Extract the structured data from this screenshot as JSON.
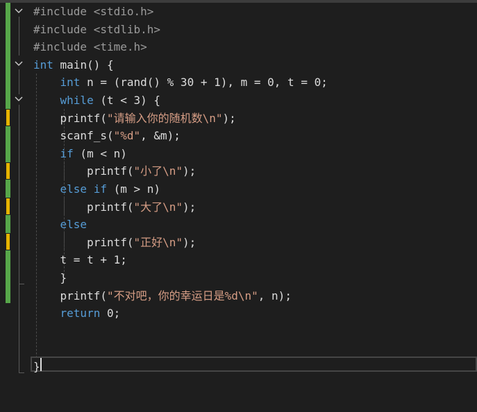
{
  "editor": {
    "language": "C",
    "lines": [
      {
        "tokens": [
          {
            "t": "#include ",
            "c": "pp"
          },
          {
            "t": "<stdio.h>",
            "c": "pp"
          }
        ]
      },
      {
        "tokens": [
          {
            "t": "#include ",
            "c": "pp"
          },
          {
            "t": "<stdlib.h>",
            "c": "pp"
          }
        ]
      },
      {
        "tokens": [
          {
            "t": "#include ",
            "c": "pp"
          },
          {
            "t": "<time.h>",
            "c": "pp"
          }
        ]
      },
      {
        "tokens": [
          {
            "t": "int",
            "c": "kw"
          },
          {
            "t": " main() {",
            "c": "plain"
          }
        ]
      },
      {
        "tokens": [
          {
            "t": "    ",
            "c": "plain"
          },
          {
            "t": "int",
            "c": "kw"
          },
          {
            "t": " n = (rand() % 30 + 1), m = 0, t = 0;",
            "c": "plain"
          }
        ]
      },
      {
        "tokens": [
          {
            "t": "    ",
            "c": "plain"
          },
          {
            "t": "while",
            "c": "kw"
          },
          {
            "t": " (t < 3) {",
            "c": "plain"
          }
        ]
      },
      {
        "tokens": [
          {
            "t": "    printf(",
            "c": "plain"
          },
          {
            "t": "\"请输入你的随机数\\n\"",
            "c": "str"
          },
          {
            "t": ");",
            "c": "plain"
          }
        ]
      },
      {
        "tokens": [
          {
            "t": "    scanf_s(",
            "c": "plain"
          },
          {
            "t": "\"%d\"",
            "c": "str"
          },
          {
            "t": ", &m);",
            "c": "plain"
          }
        ]
      },
      {
        "tokens": [
          {
            "t": "    ",
            "c": "plain"
          },
          {
            "t": "if",
            "c": "kw"
          },
          {
            "t": " (m < n)",
            "c": "plain"
          }
        ]
      },
      {
        "tokens": [
          {
            "t": "        printf(",
            "c": "plain"
          },
          {
            "t": "\"小了\\n\"",
            "c": "str"
          },
          {
            "t": ");",
            "c": "plain"
          }
        ]
      },
      {
        "tokens": [
          {
            "t": "    ",
            "c": "plain"
          },
          {
            "t": "else if",
            "c": "kw"
          },
          {
            "t": " (m > n)",
            "c": "plain"
          }
        ]
      },
      {
        "tokens": [
          {
            "t": "        printf(",
            "c": "plain"
          },
          {
            "t": "\"大了\\n\"",
            "c": "str"
          },
          {
            "t": ");",
            "c": "plain"
          }
        ]
      },
      {
        "tokens": [
          {
            "t": "    ",
            "c": "plain"
          },
          {
            "t": "else",
            "c": "kw"
          }
        ]
      },
      {
        "tokens": [
          {
            "t": "        printf(",
            "c": "plain"
          },
          {
            "t": "\"正好\\n\"",
            "c": "str"
          },
          {
            "t": ");",
            "c": "plain"
          }
        ]
      },
      {
        "tokens": [
          {
            "t": "    t = t + 1;",
            "c": "plain"
          }
        ]
      },
      {
        "tokens": [
          {
            "t": "    }",
            "c": "plain"
          }
        ]
      },
      {
        "tokens": [
          {
            "t": "    printf(",
            "c": "plain"
          },
          {
            "t": "\"不对吧，你的幸运日是%d\\n\"",
            "c": "str"
          },
          {
            "t": ", n);",
            "c": "plain"
          }
        ]
      },
      {
        "tokens": [
          {
            "t": "    ",
            "c": "plain"
          },
          {
            "t": "return",
            "c": "kw"
          },
          {
            "t": " 0;",
            "c": "plain"
          }
        ]
      },
      {
        "tokens": []
      },
      {
        "tokens": []
      },
      {
        "tokens": [
          {
            "t": "}",
            "c": "plain"
          }
        ]
      }
    ]
  },
  "colors": {
    "background": "#1e1e1e",
    "keyword": "#569cd6",
    "string": "#d69d85",
    "preprocessor": "#9b9b9b",
    "text": "#dcdcdc",
    "change_saved": "#57a64a",
    "change_unsaved": "#e6b300"
  }
}
